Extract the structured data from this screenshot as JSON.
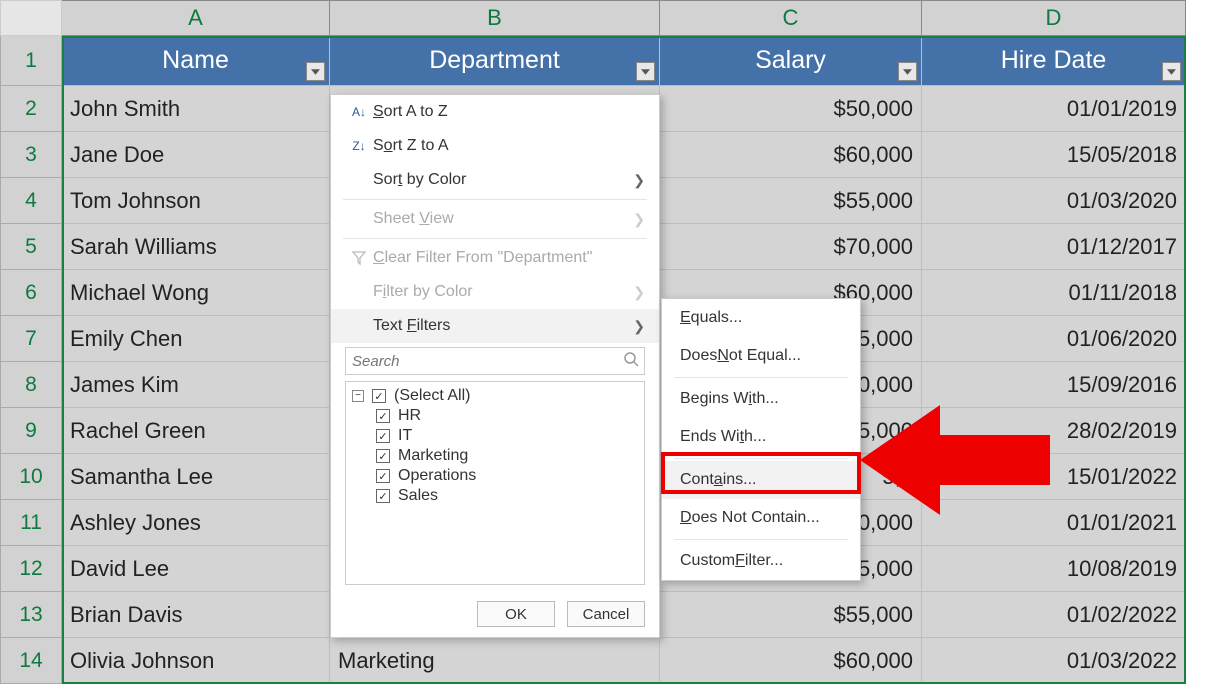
{
  "columns": [
    "A",
    "B",
    "C",
    "D"
  ],
  "table": {
    "headers": [
      "Name",
      "Department",
      "Salary",
      "Hire Date"
    ],
    "rows": [
      {
        "r": "2",
        "name": "John Smith",
        "dept": "",
        "salary": "$50,000",
        "hire": "01/01/2019"
      },
      {
        "r": "3",
        "name": "Jane Doe",
        "dept": "",
        "salary": "$60,000",
        "hire": "15/05/2018"
      },
      {
        "r": "4",
        "name": "Tom Johnson",
        "dept": "",
        "salary": "$55,000",
        "hire": "01/03/2020"
      },
      {
        "r": "5",
        "name": "Sarah Williams",
        "dept": "",
        "salary": "$70,000",
        "hire": "01/12/2017"
      },
      {
        "r": "6",
        "name": "Michael Wong",
        "dept": "",
        "salary": "$60,000",
        "hire": "01/11/2018"
      },
      {
        "r": "7",
        "name": "Emily Chen",
        "dept": "",
        "salary": "5,000",
        "hire": "01/06/2020"
      },
      {
        "r": "8",
        "name": "James Kim",
        "dept": "",
        "salary": "0,000",
        "hire": "15/09/2016"
      },
      {
        "r": "9",
        "name": "Rachel Green",
        "dept": "",
        "salary": "5,000",
        "hire": "28/02/2019"
      },
      {
        "r": "10",
        "name": "Samantha Lee",
        "dept": "",
        "salary": "5,0",
        "hire": "15/01/2022"
      },
      {
        "r": "11",
        "name": "Ashley Jones",
        "dept": "",
        "salary": "0,000",
        "hire": "01/01/2021"
      },
      {
        "r": "12",
        "name": "David Lee",
        "dept": "",
        "salary": "$65,000",
        "hire": "10/08/2019"
      },
      {
        "r": "13",
        "name": "Brian Davis",
        "dept": "",
        "salary": "$55,000",
        "hire": "01/02/2022"
      },
      {
        "r": "14",
        "name": "Olivia Johnson",
        "dept": "Marketing",
        "salary": "$60,000",
        "hire": "01/03/2022"
      }
    ]
  },
  "menu": {
    "sort_az": "Sort A to Z",
    "sort_za": "Sort Z to A",
    "sort_color": "Sort by Color",
    "sheet_view": "Sheet View",
    "clear_filter": "Clear Filter From \"Department\"",
    "filter_color": "Filter by Color",
    "text_filters": "Text Filters",
    "search_placeholder": "Search",
    "filter_items": [
      "(Select All)",
      "HR",
      "IT",
      "Marketing",
      "Operations",
      "Sales"
    ],
    "ok": "OK",
    "cancel": "Cancel"
  },
  "submenu": {
    "equals": "Equals...",
    "not_equal": "Does Not Equal...",
    "begins": "Begins With...",
    "ends": "Ends With...",
    "contains": "Contains...",
    "not_contain": "Does Not Contain...",
    "custom": "Custom Filter..."
  }
}
